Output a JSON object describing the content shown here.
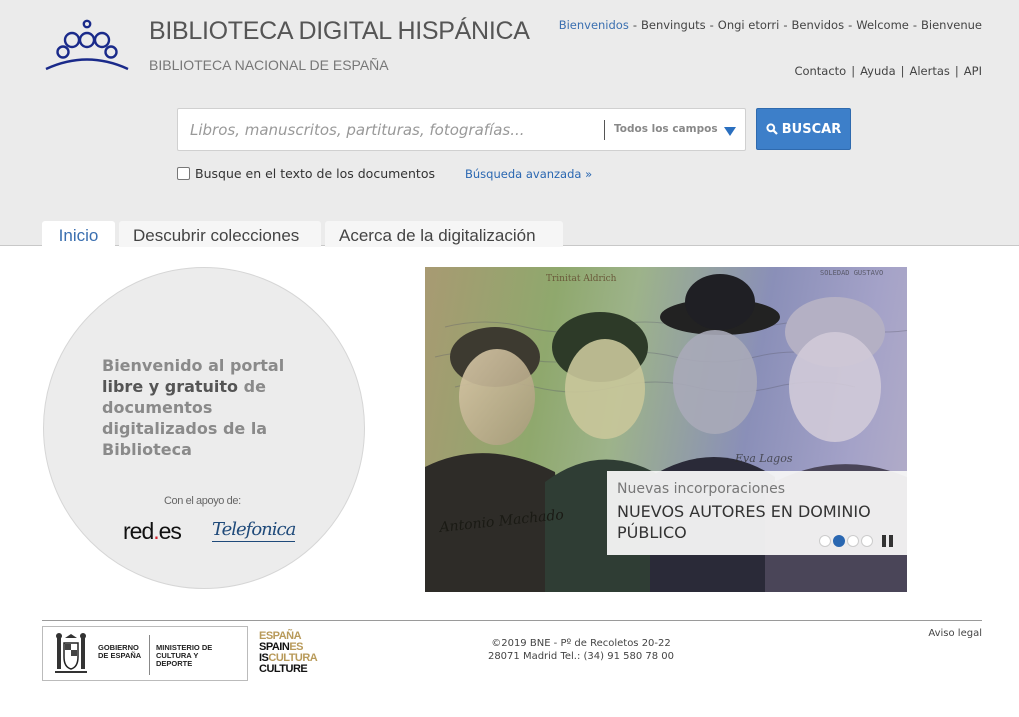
{
  "header": {
    "title": "BIBLIOTECA DIGITAL HISPÁNICA",
    "subtitle": "BIBLIOTECA NACIONAL DE ESPAÑA",
    "logo_icon": "crown-icon",
    "languages": [
      "Bienvenidos",
      "Benvinguts",
      "Ongi etorri",
      "Benvidos",
      "Welcome",
      "Bienvenue"
    ],
    "active_language": "Bienvenidos",
    "utility_links": [
      "Contacto",
      "Ayuda",
      "Alertas",
      "API"
    ]
  },
  "search": {
    "placeholder": "Libros, manuscritos, partituras, fotografías...",
    "value": "",
    "field_selected": "Todos los campos",
    "button_label": "BUSCAR",
    "button_icon": "search-icon",
    "fulltext_label": "Busque en el texto de los documentos",
    "fulltext_checked": false,
    "advanced_label": "Búsqueda avanzada »"
  },
  "tabs": [
    {
      "label": "Inicio",
      "active": true
    },
    {
      "label": "Descubrir colecciones",
      "active": false
    },
    {
      "label": "Acerca de la digitalización",
      "active": false
    }
  ],
  "welcome": {
    "line_a": "Bienvenido al portal",
    "line_b_strong": "libre y gratuito",
    "line_b_rest": " de",
    "line_c": "documentos digitalizados de la Biblioteca",
    "support_label": "Con el apoyo de:",
    "sponsor_1_pre": "red",
    "sponsor_1_dot": ".",
    "sponsor_1_post": "es",
    "sponsor_2": "Telefonica"
  },
  "carousel": {
    "kicker": "Nuevas incorporaciones",
    "title": "NUEVOS AUTORES EN DOMINIO PÚBLICO",
    "slide_count": 4,
    "active_slide": 2,
    "photo_labels": [
      "Trinitat Aldrich",
      "SOLEDAD GUSTAVO"
    ],
    "signatures": [
      "Antonio Machado",
      "Eva Lagos"
    ]
  },
  "footer": {
    "gov_name": "GOBIERNO DE ESPAÑA",
    "ministry": "MINISTERIO DE CULTURA Y DEPORTE",
    "spain_logo": [
      "ESPAÑA",
      "SPAIN",
      "ES",
      "IS",
      "CULTURA",
      "CULTURE"
    ],
    "copyright_line1": "©2019 BNE - Pº de Recoletos 20-22",
    "copyright_line2": "28071 Madrid Tel.: (34) 91 580 78 00",
    "legal": "Aviso legal"
  },
  "colors": {
    "header_bg": "#ebebeb",
    "accent_blue": "#3d7fc9",
    "link_blue": "#2a67b1",
    "tab_active_text": "#3a6fb0"
  }
}
